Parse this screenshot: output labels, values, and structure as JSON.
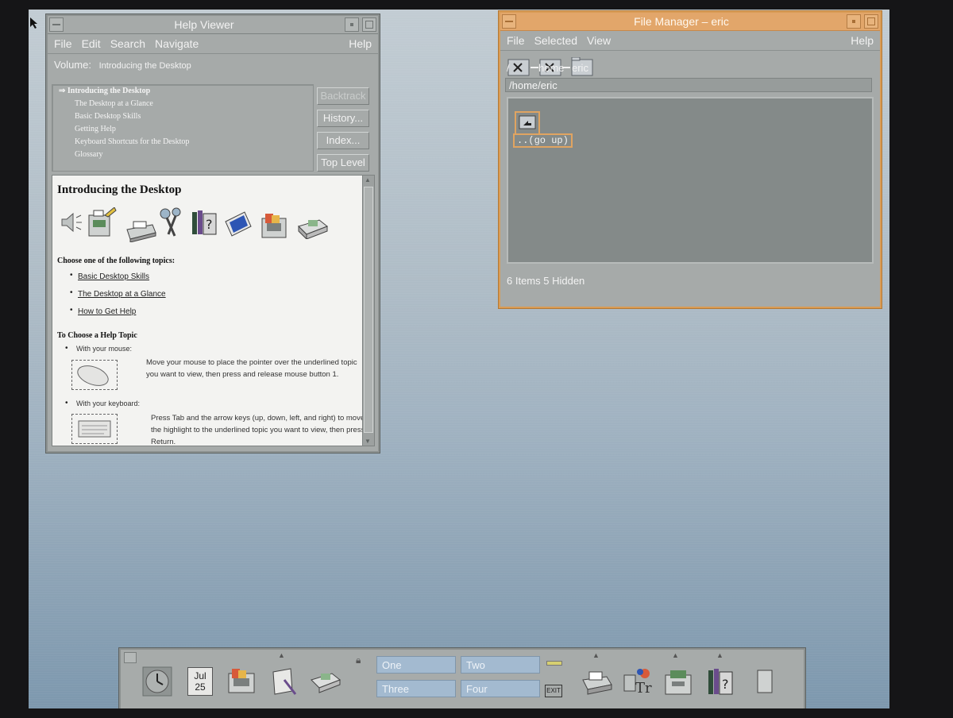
{
  "help_viewer": {
    "title": "Help Viewer",
    "menu": [
      "File",
      "Edit",
      "Search",
      "Navigate"
    ],
    "help_menu": "Help",
    "volume_label": "Volume:",
    "volume_value": "Introducing the Desktop",
    "toc": [
      "Introducing the Desktop",
      "The Desktop at a Glance",
      "Basic Desktop Skills",
      "Getting Help",
      "Keyboard Shortcuts for the Desktop",
      "Glossary"
    ],
    "buttons": {
      "backtrack": "Backtrack",
      "history": "History...",
      "index": "Index...",
      "top_level": "Top Level"
    },
    "content": {
      "heading": "Introducing the Desktop",
      "choose_heading": "Choose one of the following topics:",
      "topics": [
        "Basic Desktop Skills",
        "The Desktop at a Glance",
        "How to Get Help"
      ],
      "to_choose_heading": "To Choose a Help Topic",
      "mouse_label": "With your mouse:",
      "mouse_text": "Move your mouse to place the pointer over the underlined topic you want to view, then press and release mouse button 1.",
      "keyboard_label": "With your keyboard:",
      "keyboard_text": "Press Tab and the arrow keys (up, down, left, and right) to move the highlight to the underlined topic you want to view, then press Return."
    }
  },
  "file_manager": {
    "title": "File Manager – eric",
    "menu": [
      "File",
      "Selected",
      "View"
    ],
    "help_menu": "Help",
    "path_labels": [
      "/",
      "home",
      "eric"
    ],
    "path_field": "/home/eric",
    "go_up_label": "..(go up)",
    "status": "6 Items 5 Hidden"
  },
  "front_panel": {
    "calendar_month": "Jul",
    "calendar_day": "25",
    "workspaces": [
      "One",
      "Two",
      "Three",
      "Four"
    ],
    "exit_label": "EXIT"
  },
  "colors": {
    "fm_accent": "#e2a66a",
    "workspace_button": "#a3bad0",
    "window_gray": "#a6aaa9"
  }
}
